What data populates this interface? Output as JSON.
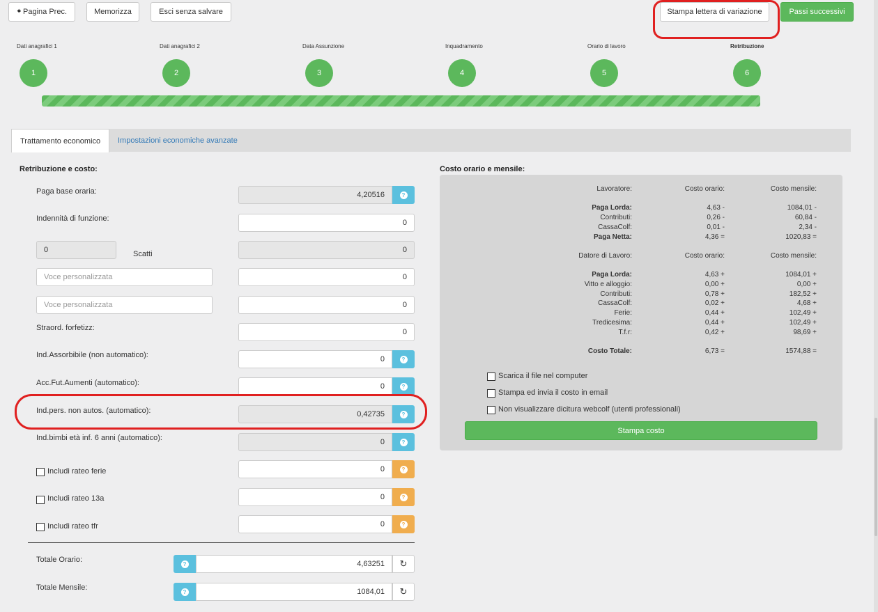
{
  "toolbar": {
    "prev_label": "Pagina Prec.",
    "save_label": "Memorizza",
    "exit_label": "Esci senza salvare",
    "print_letter_label": "Stampa lettera di variazione",
    "next_label": "Passi successivi"
  },
  "steps": [
    {
      "label": "Dati anagrafici 1",
      "num": "1"
    },
    {
      "label": "Dati anagrafici 2",
      "num": "2"
    },
    {
      "label": "Data Assunzione",
      "num": "3"
    },
    {
      "label": "Inquadramento",
      "num": "4"
    },
    {
      "label": "Orario di lavoro",
      "num": "5"
    },
    {
      "label": "Retribuzione",
      "num": "6"
    }
  ],
  "progress": 1.0,
  "tabs": [
    "Trattamento economico",
    "Impostazioni economiche avanzate"
  ],
  "left": {
    "title": "Retribuzione e costo:",
    "paga_base_label": "Paga base oraria:",
    "paga_base_value": "4,20516",
    "indennita_label": "Indennità di funzione:",
    "indennita_value": "0",
    "scatti_count": "0",
    "scatti_label": "Scatti",
    "scatti_value": "0",
    "voce1_placeholder": "Voce personalizzata",
    "voce1_value": "0",
    "voce2_placeholder": "Voce personalizzata",
    "voce2_value": "0",
    "straord_label": "Straord. forfetizz:",
    "straord_value": "0",
    "ind_assorb_label": "Ind.Assorbibile (non automatico):",
    "ind_assorb_value": "0",
    "acc_fut_label": "Acc.Fut.Aumenti (automatico):",
    "acc_fut_value": "0",
    "ind_pers_label": "Ind.pers. non autos. (automatico):",
    "ind_pers_value": "0,42735",
    "ind_bimbi_label": "Ind.bimbi età inf. 6 anni (automatico):",
    "ind_bimbi_value": "0",
    "rateo_ferie_label": "Includi rateo ferie",
    "rateo_ferie_value": "0",
    "rateo_13a_label": "Includi rateo 13a",
    "rateo_13a_value": "0",
    "rateo_tfr_label": "Includi rateo tfr",
    "rateo_tfr_value": "0",
    "totale_orario_label": "Totale Orario:",
    "totale_orario_value": "4,63251",
    "totale_mensile_label": "Totale Mensile:",
    "totale_mensile_value": "1084,01"
  },
  "right": {
    "title": "Costo orario e mensile:",
    "lav_header": [
      "Lavoratore:",
      "Costo orario:",
      "Costo mensile:"
    ],
    "lav_rows": [
      {
        "label": "Paga Lorda:",
        "h": "4,63 -",
        "m": "1084,01 -",
        "bold": true
      },
      {
        "label": "Contributi:",
        "h": "0,26 -",
        "m": "60,84 -",
        "bold": false
      },
      {
        "label": "CassaColf:",
        "h": "0,01 -",
        "m": "2,34 -",
        "bold": false
      },
      {
        "label": "Paga Netta:",
        "h": "4,36 =",
        "m": "1020,83 =",
        "bold": true
      }
    ],
    "dat_header": [
      "Datore di Lavoro:",
      "Costo orario:",
      "Costo mensile:"
    ],
    "dat_rows": [
      {
        "label": "Paga Lorda:",
        "h": "4,63 +",
        "m": "1084,01 +",
        "bold": true
      },
      {
        "label": "Vitto e alloggio:",
        "h": "0,00 +",
        "m": "0,00 +",
        "bold": false
      },
      {
        "label": "Contributi:",
        "h": "0,78 +",
        "m": "182,52 +",
        "bold": false
      },
      {
        "label": "CassaColf:",
        "h": "0,02 +",
        "m": "4,68 +",
        "bold": false
      },
      {
        "label": "Ferie:",
        "h": "0,44 +",
        "m": "102,49 +",
        "bold": false
      },
      {
        "label": "Tredicesima:",
        "h": "0,44 +",
        "m": "102,49 +",
        "bold": false
      },
      {
        "label": "T.f.r:",
        "h": "0,42 +",
        "m": "98,69 +",
        "bold": false
      }
    ],
    "totale": {
      "label": "Costo Totale:",
      "h": "6,73 =",
      "m": "1574,88 ="
    },
    "opt_scarica": "Scarica il file nel computer",
    "opt_email": "Stampa ed invia il costo in email",
    "opt_dicitura": "Non visualizzare dicitura webcolf (utenti professionali)",
    "print_label": "Stampa costo"
  }
}
